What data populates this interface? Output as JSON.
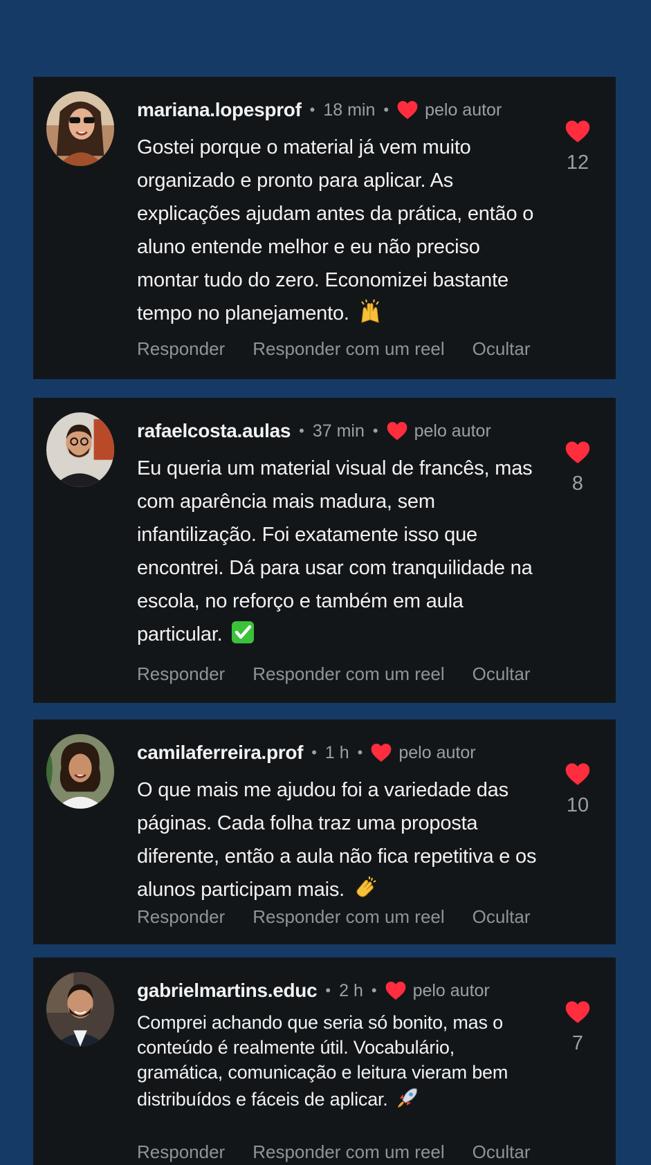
{
  "colors": {
    "page_bg": "#163a66",
    "card_bg": "#131619",
    "heart": "#ff2d3d",
    "muted_text": "#9aa0a6",
    "primary_text": "#f2f2f2"
  },
  "comments": [
    {
      "username": "mariana.lopesprof",
      "time": "18 min",
      "liked_by_author_label": "pelo autor",
      "text": "Gostei porque o material já vem muito organizado e pronto para aplicar. As explicações ajudam antes da prática, então o aluno entende melhor e eu não preciso montar tudo do zero. Economizei bastante tempo no planejamento.",
      "emoji": "raising-hands-emoji",
      "likes": "12",
      "actions": {
        "reply": "Responder",
        "reply_reel": "Responder com um reel",
        "hide": "Ocultar"
      }
    },
    {
      "username": "rafaelcosta.aulas",
      "time": "37 min",
      "liked_by_author_label": "pelo autor",
      "text": "Eu queria um material visual de francês, mas com aparência mais madura, sem infantilização. Foi exatamente isso que encontrei. Dá para usar com tranquilidade na escola, no reforço e também em aula particular.",
      "emoji": "check-mark-emoji",
      "likes": "8",
      "actions": {
        "reply": "Responder",
        "reply_reel": "Responder com um reel",
        "hide": "Ocultar"
      }
    },
    {
      "username": "camilaferreira.prof",
      "time": "1 h",
      "liked_by_author_label": "pelo autor",
      "text": "O que mais me ajudou foi a variedade das páginas. Cada folha traz uma proposta diferente, então a aula não fica repetitiva e os alunos participam mais.",
      "emoji": "clapping-hands-emoji",
      "likes": "10",
      "actions": {
        "reply": "Responder",
        "reply_reel": "Responder com um reel",
        "hide": "Ocultar"
      }
    },
    {
      "username": "gabrielmartins.educ",
      "time": "2 h",
      "liked_by_author_label": "pelo autor",
      "text": "Comprei achando que seria só bonito, mas o conteúdo é realmente útil. Vocabulário, gramática, comunicação e leitura vieram bem distribuídos e fáceis de aplicar.",
      "emoji": "rocket-emoji",
      "likes": "7",
      "actions": {
        "reply": "Responder",
        "reply_reel": "Responder com um reel",
        "hide": "Ocultar"
      }
    }
  ]
}
